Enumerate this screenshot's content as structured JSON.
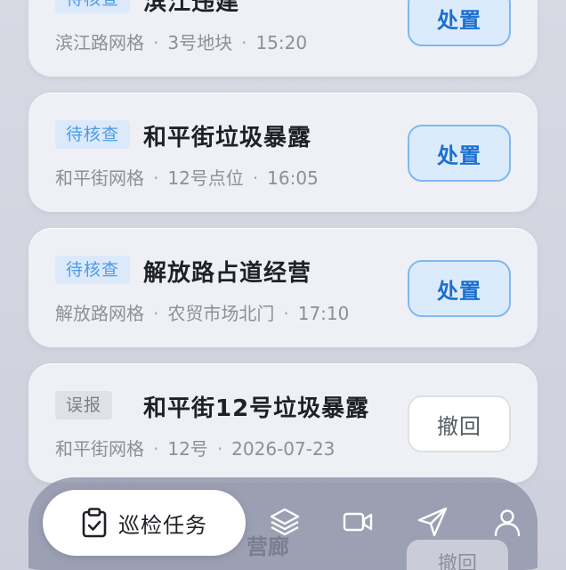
{
  "tasks": [
    {
      "badge": "待核查",
      "title": "滨江违建",
      "grid": "滨江路网格",
      "location": "3号地块",
      "time": "15:20",
      "action": "处置",
      "status": "pending"
    },
    {
      "badge": "待核查",
      "title": "和平街垃圾暴露",
      "grid": "和平街网格",
      "location": "12号点位",
      "time": "16:05",
      "action": "处置",
      "status": "pending"
    },
    {
      "badge": "待核查",
      "title": "解放路占道经营",
      "grid": "解放路网格",
      "location": "农贸市场北门",
      "time": "17:10",
      "action": "处置",
      "status": "pending"
    },
    {
      "badge": "误报",
      "title": "和平街12号垃圾暴露",
      "grid": "和平街网格",
      "location": "12号",
      "time": "2026-07-23",
      "action": "撤回",
      "status": "false"
    }
  ],
  "behind_tabbar": {
    "title_fragment": "营廊",
    "button": "撤回"
  },
  "tabbar": {
    "active_label": "巡检任务",
    "icons": [
      "clipboard-check-icon",
      "layers-icon",
      "video-camera-icon",
      "send-icon",
      "user-icon"
    ]
  },
  "colors": {
    "accent": "#1a6fd0",
    "badge_pending": "#4d9be8",
    "text": "#1e2126"
  }
}
